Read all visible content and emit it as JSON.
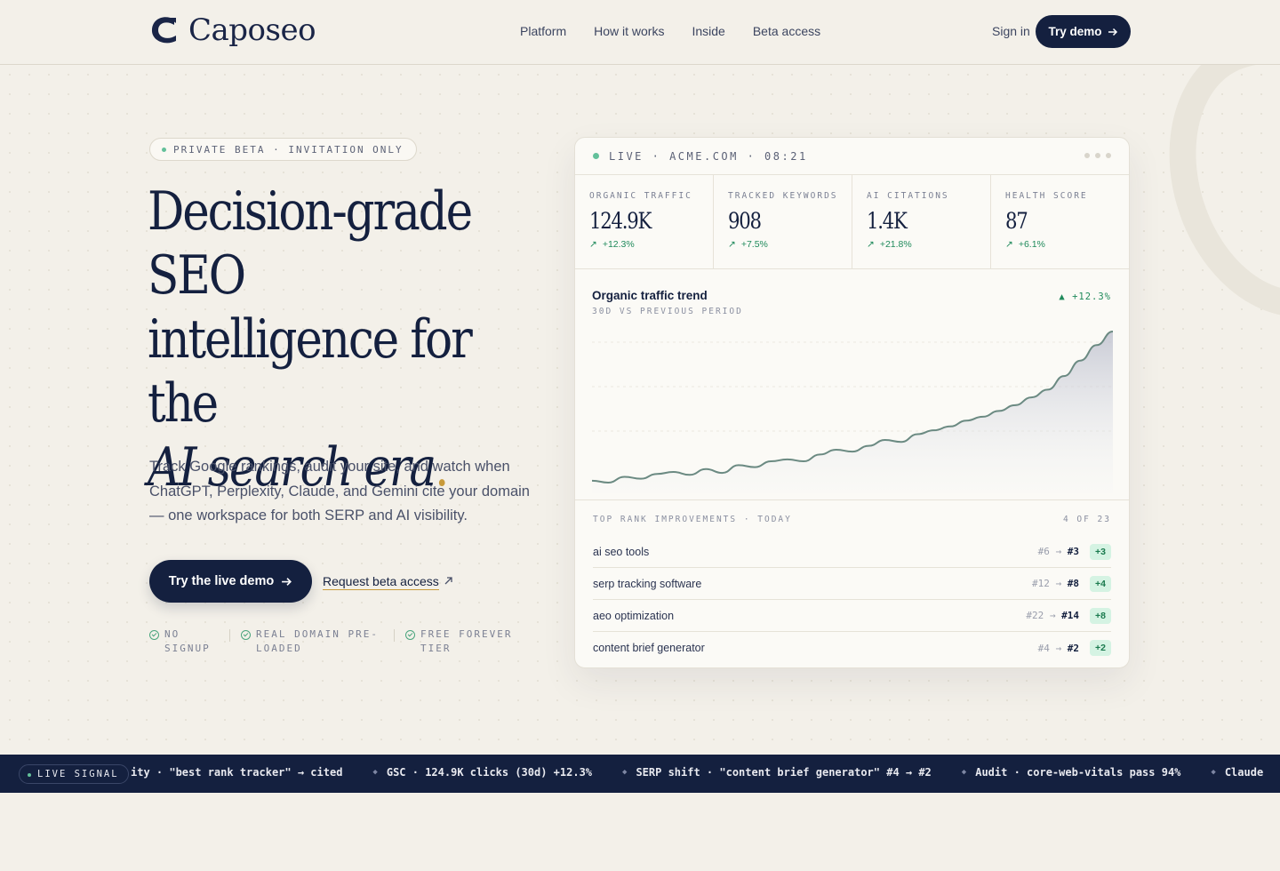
{
  "header": {
    "brand": "Caposeo",
    "nav": [
      "Platform",
      "How it works",
      "Inside",
      "Beta access"
    ],
    "signin": "Sign in",
    "cta": "Try demo"
  },
  "hero": {
    "badge": "PRIVATE BETA · INVITATION ONLY",
    "headline_line1": "Decision-grade",
    "headline_line2": "SEO",
    "headline_line3": "intelligence for the",
    "headline_italic": "AI search era",
    "headline_dot": ".",
    "subtext": "Track Google rankings, audit your site, and watch when ChatGPT, Perplexity, Claude, and Gemini cite your domain — one workspace for both SERP and AI visibility.",
    "primary_cta": "Try the live demo",
    "secondary_cta": "Request beta access",
    "perks": [
      "NO SIGNUP",
      "REAL DOMAIN PRE-LOADED",
      "FREE FOREVER TIER"
    ]
  },
  "dashboard": {
    "top_bar": "LIVE · ACME.COM · 08:21",
    "kpis": [
      {
        "label": "ORGANIC TRAFFIC",
        "value": "124.9K",
        "delta": "+12.3%"
      },
      {
        "label": "TRACKED KEYWORDS",
        "value": "908",
        "delta": "+7.5%"
      },
      {
        "label": "AI CITATIONS",
        "value": "1.4K",
        "delta": "+21.8%"
      },
      {
        "label": "HEALTH SCORE",
        "value": "87",
        "delta": "+6.1%"
      }
    ],
    "chart_title": "Organic traffic trend",
    "chart_subtitle": "30D VS PREVIOUS PERIOD",
    "chart_delta": "▲ +12.3%",
    "ranks_title": "TOP RANK IMPROVEMENTS · TODAY",
    "ranks_count": "4 OF 23",
    "ranks": [
      {
        "keyword": "ai seo tools",
        "from": "#6",
        "to": "#3",
        "change": "+3"
      },
      {
        "keyword": "serp tracking software",
        "from": "#12",
        "to": "#8",
        "change": "+4"
      },
      {
        "keyword": "aeo optimization",
        "from": "#22",
        "to": "#14",
        "change": "+8"
      },
      {
        "keyword": "content brief generator",
        "from": "#4",
        "to": "#2",
        "change": "+2"
      }
    ]
  },
  "chart_data": {
    "type": "area",
    "title": "",
    "xlabel": "",
    "ylabel": "",
    "y": [
      18,
      16,
      22,
      20,
      25,
      27,
      24,
      30,
      26,
      34,
      32,
      38,
      40,
      38,
      45,
      50,
      48,
      54,
      60,
      58,
      66,
      70,
      74,
      80,
      84,
      90,
      96,
      104,
      112,
      126,
      142,
      158,
      172
    ]
  },
  "ticker": {
    "badge": "LIVE SIGNAL",
    "items": [
      "ity · \"best rank tracker\" → cited",
      "GSC · 124.9K clicks (30d) +12.3%",
      "SERP shift · \"content brief generator\" #4 → #2",
      "Audit · core-web-vitals pass 94%",
      "Claude"
    ]
  },
  "colors": {
    "navy": "#14203f",
    "accent_gold": "#c89a3a",
    "positive_green": "#1f8a5b",
    "live_green": "#63c09a",
    "background": "#f3f0e9"
  }
}
